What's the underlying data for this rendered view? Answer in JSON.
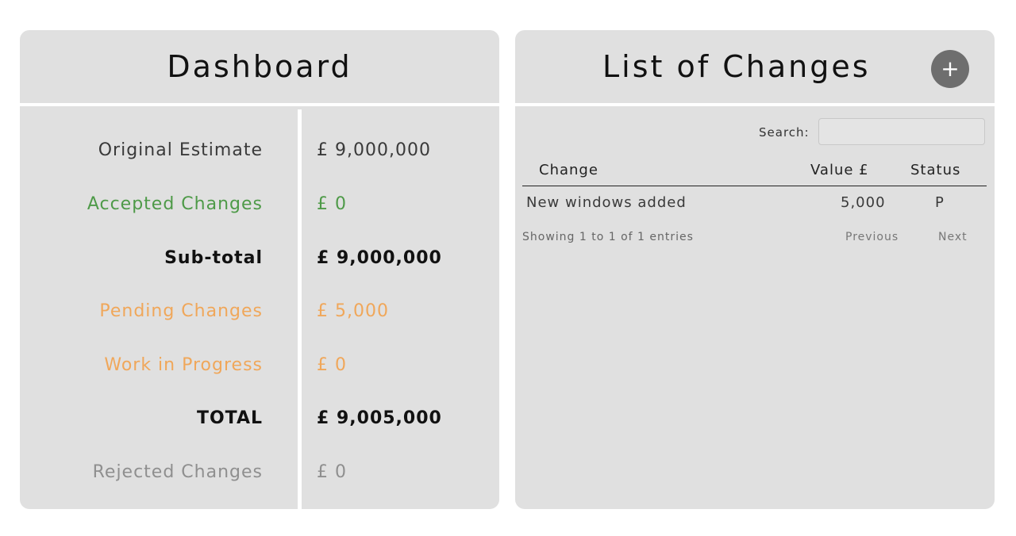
{
  "dashboard": {
    "title": "Dashboard",
    "rows": [
      {
        "label": "Original Estimate",
        "value": "£ 9,000,000"
      },
      {
        "label": "Accepted Changes",
        "value": "£ 0"
      },
      {
        "label": "Sub-total",
        "value": "£ 9,000,000"
      },
      {
        "label": "Pending Changes",
        "value": "£ 5,000"
      },
      {
        "label": "Work in Progress",
        "value": "£ 0"
      },
      {
        "label": "TOTAL",
        "value": "£ 9,005,000"
      },
      {
        "label": "Rejected Changes",
        "value": "£ 0"
      }
    ]
  },
  "changes": {
    "title": "List of Changes",
    "add_button": "+",
    "search": {
      "label": "Search:",
      "value": ""
    },
    "columns": {
      "change": "Change",
      "value": "Value £",
      "status": "Status"
    },
    "rows": [
      {
        "change": "New windows added",
        "value": "5,000",
        "status": "P"
      }
    ],
    "footer": {
      "info": "Showing 1 to 1 of 1 entries",
      "previous": "Previous",
      "next": "Next"
    }
  },
  "colors": {
    "panel_bg": "#e0e0e0",
    "accepted": "#4e9a48",
    "pending": "#f0a75a",
    "rejected": "#8f8f8f",
    "add_button": "#6e6e6e"
  }
}
